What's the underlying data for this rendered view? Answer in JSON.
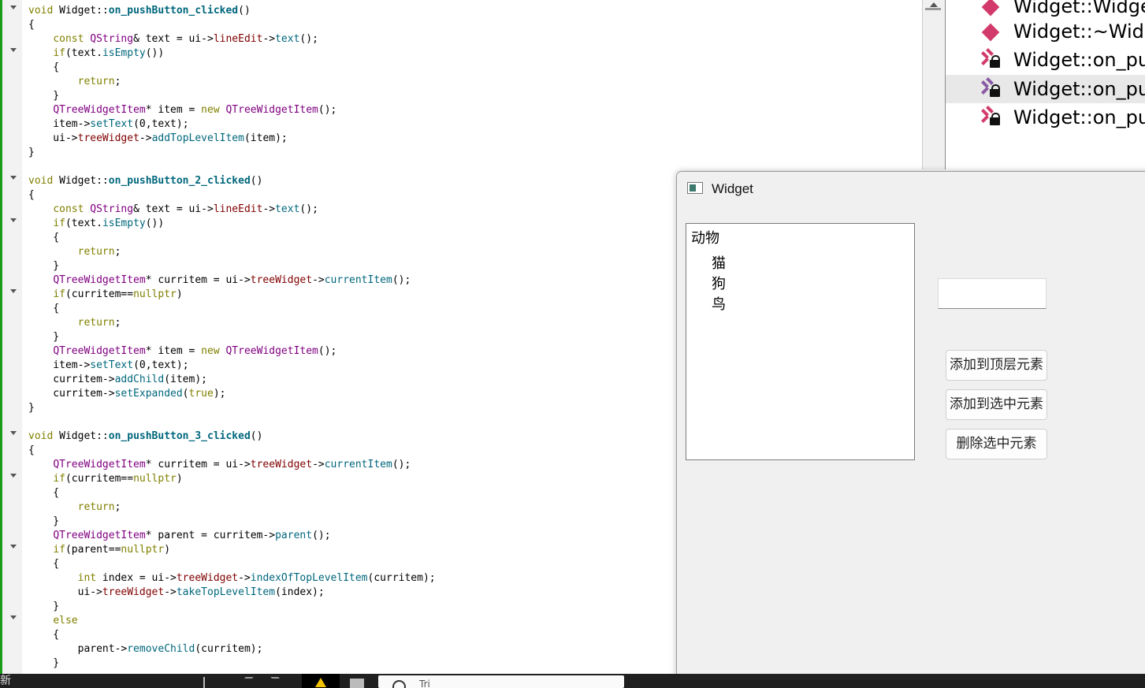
{
  "editor": {
    "lines": [
      "void Widget::on_pushButton_clicked()",
      "{",
      "    const QString& text = ui->lineEdit->text();",
      "    if(text.isEmpty())",
      "    {",
      "        return;",
      "    }",
      "    QTreeWidgetItem* item = new QTreeWidgetItem();",
      "    item->setText(0,text);",
      "    ui->treeWidget->addTopLevelItem(item);",
      "}",
      "",
      "void Widget::on_pushButton_2_clicked()",
      "{",
      "    const QString& text = ui->lineEdit->text();",
      "    if(text.isEmpty())",
      "    {",
      "        return;",
      "    }",
      "    QTreeWidgetItem* curritem = ui->treeWidget->currentItem();",
      "    if(curritem==nullptr)",
      "    {",
      "        return;",
      "    }",
      "    QTreeWidgetItem* item = new QTreeWidgetItem();",
      "    item->setText(0,text);",
      "    curritem->addChild(item);",
      "    curritem->setExpanded(true);",
      "}",
      "",
      "void Widget::on_pushButton_3_clicked()",
      "{",
      "    QTreeWidgetItem* curritem = ui->treeWidget->currentItem();",
      "    if(curritem==nullptr)",
      "    {",
      "        return;",
      "    }",
      "    QTreeWidgetItem* parent = curritem->parent();",
      "    if(parent==nullptr)",
      "    {",
      "        int index = ui->treeWidget->indexOfTopLevelItem(curritem);",
      "        ui->treeWidget->takeTopLevelItem(index);",
      "    }",
      "    else",
      "    {",
      "        parent->removeChild(curritem);",
      "    }"
    ],
    "fold_lines": [
      0,
      3,
      12,
      15,
      20,
      30,
      33,
      38,
      43
    ]
  },
  "outline": {
    "items": [
      {
        "label": "Widget::Widge",
        "icon": "constructor-icon"
      },
      {
        "label": "Widget::~Widg",
        "icon": "destructor-icon"
      },
      {
        "label": "Widget::on_pu",
        "icon": "private-slot-icon"
      },
      {
        "label": "Widget::on_pu",
        "icon": "private-slot-icon"
      },
      {
        "label": "Widget::on_pu",
        "icon": "private-slot-icon"
      }
    ],
    "selected_index": 3
  },
  "widget_window": {
    "title": "Widget",
    "tree": {
      "root": "动物",
      "children": [
        "猫",
        "狗",
        "鸟"
      ]
    },
    "line_edit_value": "",
    "buttons": {
      "add_top": "添加到顶层元素",
      "add_selected": "添加到选中元素",
      "delete_selected": "删除选中元素"
    }
  },
  "taskbar": {
    "left_char": "新",
    "search_placeholder": "Tri"
  }
}
